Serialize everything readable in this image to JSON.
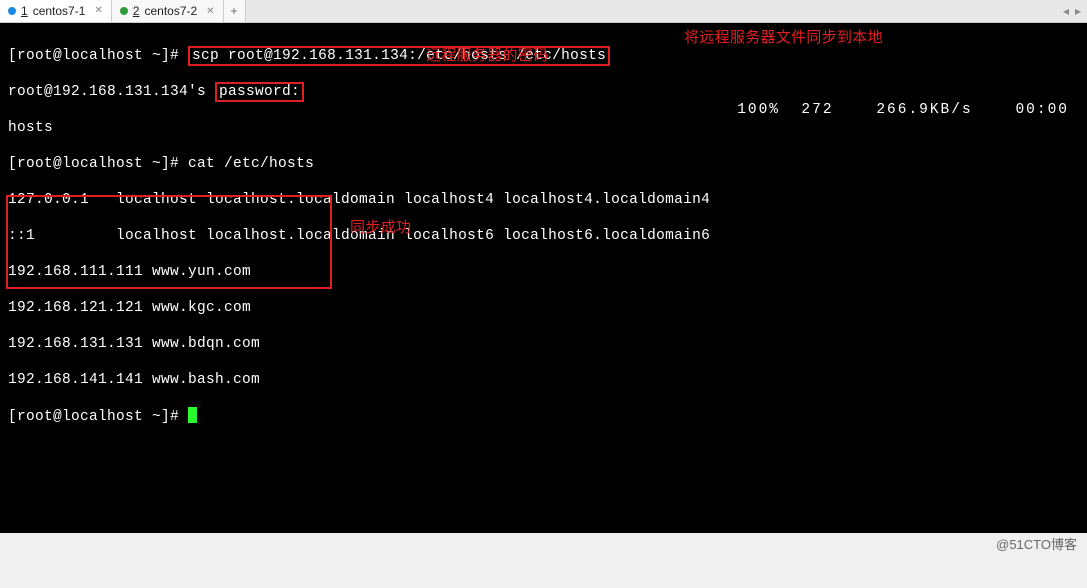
{
  "tabs": [
    {
      "num": "1",
      "label": "centos7-1",
      "dot": "blue",
      "active": true
    },
    {
      "num": "2",
      "label": "centos7-2",
      "dot": "green",
      "active": false
    }
  ],
  "prompt": "[root@localhost ~]#",
  "scp_cmd": "scp root@192.168.131.134:/etc/hosts /etc/hosts",
  "annot_scp": "将远程服务器文件同步到本地",
  "pw_line_prefix": "root@192.168.131.134's ",
  "pw_box": "password:",
  "annot_pw": "远程服务器的密码",
  "hosts_result": "hosts",
  "stats": {
    "pct": "100%",
    "bytes": "272",
    "speed": "266.9KB/s",
    "time": "00:00"
  },
  "cat_cmd": "cat /etc/hosts",
  "cat_out_1": "127.0.0.1   localhost localhost.localdomain localhost4 localhost4.localdomain4",
  "cat_out_2": "::1         localhost localhost.localdomain localhost6 localhost6.localdomain6",
  "host_lines": [
    "192.168.111.111 www.yun.com",
    "192.168.121.121 www.kgc.com",
    "192.168.131.131 www.bdqn.com",
    "192.168.141.141 www.bash.com"
  ],
  "annot_ok": "同步成功",
  "watermark": "@51CTO博客"
}
